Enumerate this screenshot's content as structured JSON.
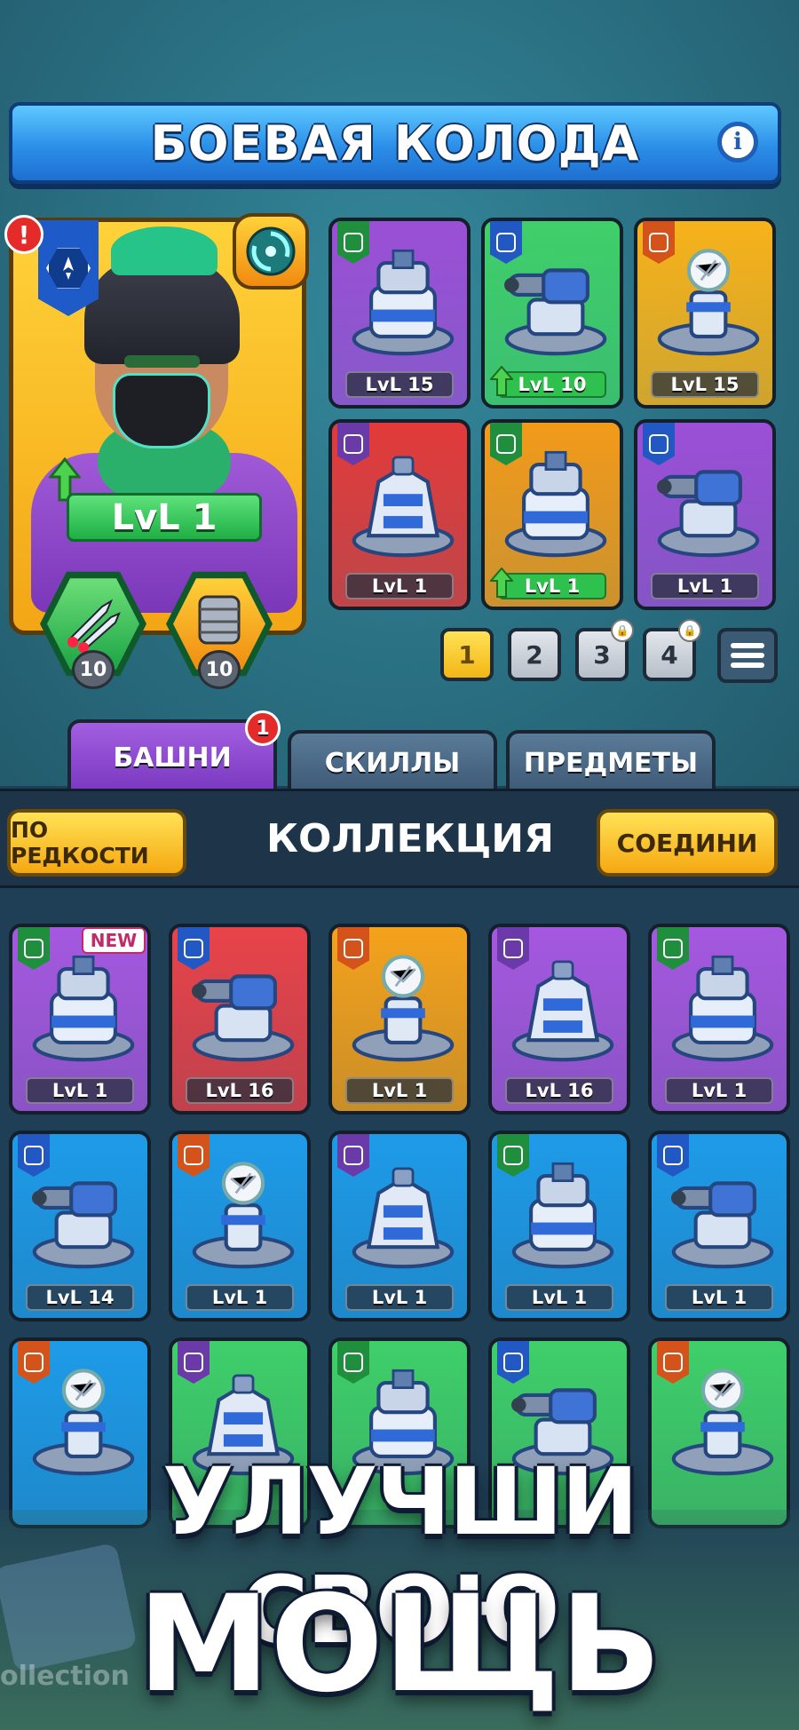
{
  "header": {
    "title": "БОЕВАЯ КОЛОДА",
    "info_label": "i"
  },
  "hero": {
    "level": "LvL 1",
    "alert": "!",
    "items": [
      {
        "level": "10"
      },
      {
        "level": "10"
      }
    ]
  },
  "deck": [
    {
      "level": "LvL 15",
      "bg": "#9b4fd6"
    },
    {
      "level": "LvL 10",
      "bg": "#3fcf6a",
      "upgrade": true
    },
    {
      "level": "LvL 15",
      "bg": "#f7b21a"
    },
    {
      "level": "LvL 1",
      "bg": "#e23a3a"
    },
    {
      "level": "LvL 1",
      "bg": "#f29a1a",
      "upgrade": true
    },
    {
      "level": "LvL 1",
      "bg": "#9b4fd6"
    }
  ],
  "deck_pages": [
    "1",
    "2",
    "3",
    "4"
  ],
  "tabs": [
    {
      "label": "БАШНИ",
      "badge": "1"
    },
    {
      "label": "СКИЛЛЫ"
    },
    {
      "label": "ПРЕДМЕТЫ"
    }
  ],
  "collection_bar": {
    "sort_label": "ПО РЕДКОСТИ",
    "title": "КОЛЛЕКЦИЯ",
    "merge_label": "СОЕДИНИ"
  },
  "collection": [
    {
      "level": "LvL 1",
      "bg": "#a558e0",
      "new": "NEW"
    },
    {
      "level": "LvL 16",
      "bg": "#e8434a"
    },
    {
      "level": "LvL 1",
      "bg": "#f4a21c"
    },
    {
      "level": "LvL 16",
      "bg": "#a558e0"
    },
    {
      "level": "LvL 1",
      "bg": "#a558e0"
    },
    {
      "level": "LvL 14",
      "bg": "#1e9be8"
    },
    {
      "level": "LvL 1",
      "bg": "#1e9be8"
    },
    {
      "level": "LvL 1",
      "bg": "#1e9be8"
    },
    {
      "level": "LvL 1",
      "bg": "#1e9be8"
    },
    {
      "level": "LvL 1",
      "bg": "#1e9be8"
    },
    {
      "bg": "#1e9be8"
    },
    {
      "bg": "#3fcf6a"
    },
    {
      "bg": "#3fcf6a"
    },
    {
      "bg": "#3fcf6a"
    },
    {
      "bg": "#3fcf6a"
    }
  ],
  "promo": {
    "line1": "УЛУЧШИ СВОЮ",
    "line2": "МОЩЬ"
  },
  "background_text": "ollection"
}
